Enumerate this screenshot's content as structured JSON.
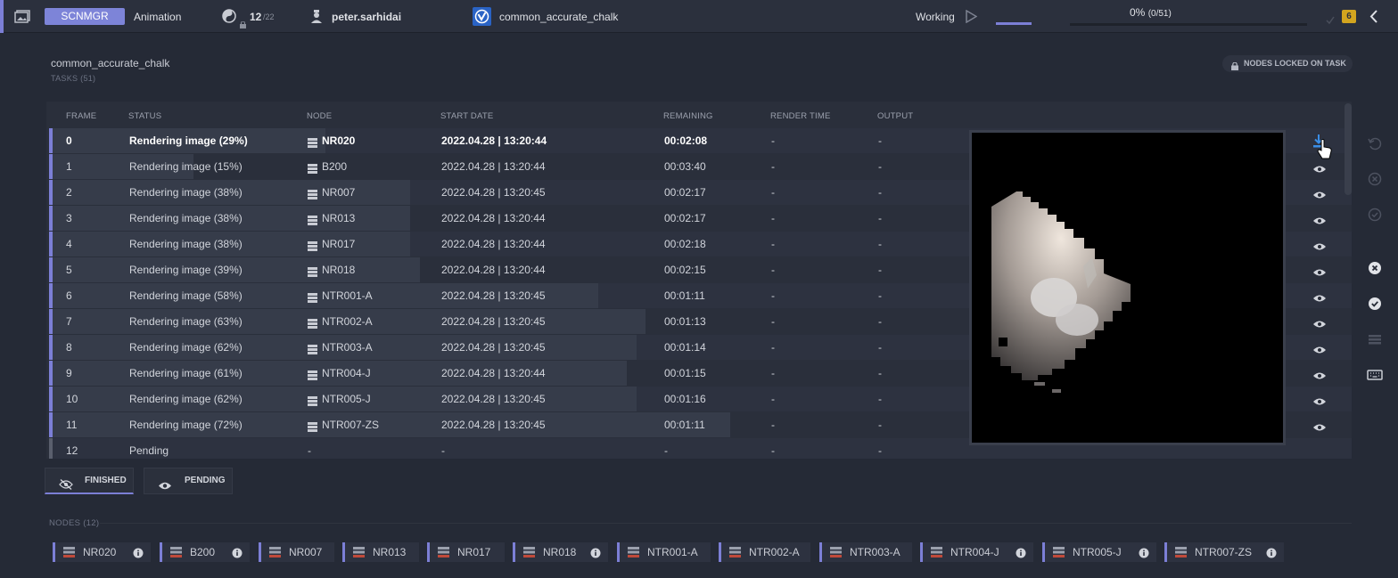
{
  "topbar": {
    "app_chip": "SCNMGR",
    "job_type": "Animation",
    "nodes_count": "12",
    "nodes_total": "/22",
    "user": "peter.sarhidai",
    "project": "common_accurate_chalk",
    "status": "Working",
    "progress_text": "0%",
    "progress_count": "(0/51)",
    "progress_value": 0,
    "badge": "6"
  },
  "page": {
    "title": "common_accurate_chalk",
    "tasks_label": "TASKS (51)",
    "locked_label": "NODES LOCKED ON TASK"
  },
  "table": {
    "headers": [
      "FRAME",
      "STATUS",
      "NODE",
      "START DATE",
      "REMAINING",
      "RENDER TIME",
      "OUTPUT"
    ],
    "rows": [
      {
        "frame": "0",
        "status": "Rendering image (29%)",
        "node": "NR020",
        "start": "2022.04.28 | 13:20:44",
        "remaining": "00:02:08",
        "render": "-",
        "output": "-",
        "progress": 0.29
      },
      {
        "frame": "1",
        "status": "Rendering image (15%)",
        "node": "B200",
        "start": "2022.04.28 | 13:20:44",
        "remaining": "00:03:40",
        "render": "-",
        "output": "-",
        "progress": 0.15
      },
      {
        "frame": "2",
        "status": "Rendering image (38%)",
        "node": "NR007",
        "start": "2022.04.28 | 13:20:45",
        "remaining": "00:02:17",
        "render": "-",
        "output": "-",
        "progress": 0.38
      },
      {
        "frame": "3",
        "status": "Rendering image (38%)",
        "node": "NR013",
        "start": "2022.04.28 | 13:20:44",
        "remaining": "00:02:17",
        "render": "-",
        "output": "-",
        "progress": 0.38
      },
      {
        "frame": "4",
        "status": "Rendering image (38%)",
        "node": "NR017",
        "start": "2022.04.28 | 13:20:44",
        "remaining": "00:02:18",
        "render": "-",
        "output": "-",
        "progress": 0.38
      },
      {
        "frame": "5",
        "status": "Rendering image (39%)",
        "node": "NR018",
        "start": "2022.04.28 | 13:20:44",
        "remaining": "00:02:15",
        "render": "-",
        "output": "-",
        "progress": 0.39
      },
      {
        "frame": "6",
        "status": "Rendering image (58%)",
        "node": "NTR001-A",
        "start": "2022.04.28 | 13:20:45",
        "remaining": "00:01:11",
        "render": "-",
        "output": "-",
        "progress": 0.58
      },
      {
        "frame": "7",
        "status": "Rendering image (63%)",
        "node": "NTR002-A",
        "start": "2022.04.28 | 13:20:45",
        "remaining": "00:01:13",
        "render": "-",
        "output": "-",
        "progress": 0.63
      },
      {
        "frame": "8",
        "status": "Rendering image (62%)",
        "node": "NTR003-A",
        "start": "2022.04.28 | 13:20:45",
        "remaining": "00:01:14",
        "render": "-",
        "output": "-",
        "progress": 0.62
      },
      {
        "frame": "9",
        "status": "Rendering image (61%)",
        "node": "NTR004-J",
        "start": "2022.04.28 | 13:20:44",
        "remaining": "00:01:15",
        "render": "-",
        "output": "-",
        "progress": 0.61
      },
      {
        "frame": "10",
        "status": "Rendering image (62%)",
        "node": "NTR005-J",
        "start": "2022.04.28 | 13:20:45",
        "remaining": "00:01:16",
        "render": "-",
        "output": "-",
        "progress": 0.62
      },
      {
        "frame": "11",
        "status": "Rendering image (72%)",
        "node": "NTR007-ZS",
        "start": "2022.04.28 | 13:20:45",
        "remaining": "00:01:11",
        "render": "-",
        "output": "-",
        "progress": 0.72
      },
      {
        "frame": "12",
        "status": "Pending",
        "node": "-",
        "start": "-",
        "remaining": "-",
        "render": "-",
        "output": "-",
        "progress": 0
      }
    ]
  },
  "filters": {
    "finished": "FINISHED",
    "pending": "PENDING"
  },
  "nodes": {
    "label": "NODES (12)",
    "items": [
      {
        "name": "NR020",
        "info": true
      },
      {
        "name": "B200",
        "info": true
      },
      {
        "name": "NR007",
        "info": false
      },
      {
        "name": "NR013",
        "info": false
      },
      {
        "name": "NR017",
        "info": false
      },
      {
        "name": "NR018",
        "info": true
      },
      {
        "name": "NTR001-A",
        "info": false
      },
      {
        "name": "NTR002-A",
        "info": false
      },
      {
        "name": "NTR003-A",
        "info": false
      },
      {
        "name": "NTR004-J",
        "info": true
      },
      {
        "name": "NTR005-J",
        "info": true
      },
      {
        "name": "NTR007-ZS",
        "info": true
      }
    ]
  },
  "colors": {
    "accent": "#7c7fd6",
    "badge": "#d3a51f",
    "download": "#3a8ee6"
  },
  "icons": [
    "image-icon",
    "yin-yang-icon",
    "lock-icon",
    "user-icon",
    "project-logo-icon",
    "play-icon",
    "check-icon",
    "chevron-left-icon",
    "server-icon",
    "eye-icon",
    "eye-off-icon",
    "download-icon",
    "undo-icon",
    "cancel-icon",
    "check-circle-icon",
    "list-icon",
    "keyboard-icon",
    "info-icon"
  ]
}
